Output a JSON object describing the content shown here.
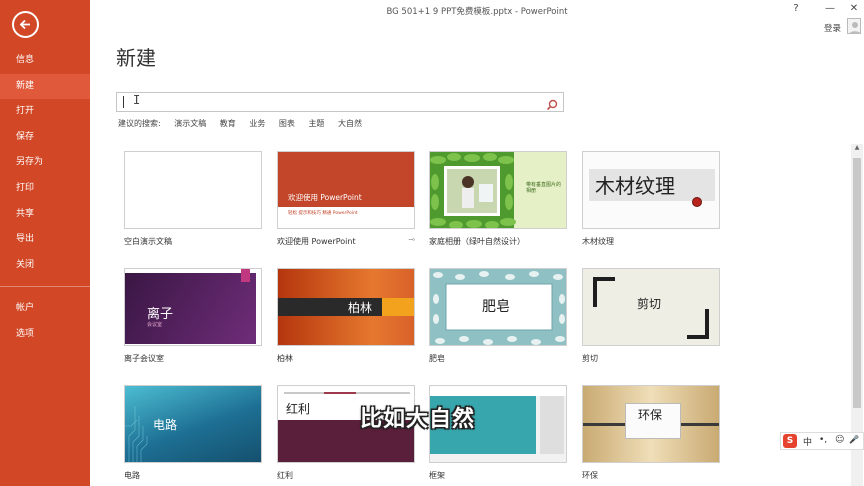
{
  "window": {
    "title": "BG 501+1 9 PPT免费模板.pptx - PowerPoint",
    "help": "?",
    "minimize": "—",
    "close": "✕",
    "login": "登录"
  },
  "sidebar": {
    "items": [
      {
        "label": "信息"
      },
      {
        "label": "新建"
      },
      {
        "label": "打开"
      },
      {
        "label": "保存"
      },
      {
        "label": "另存为"
      },
      {
        "label": "打印"
      },
      {
        "label": "共享"
      },
      {
        "label": "导出"
      },
      {
        "label": "关闭"
      },
      {
        "label": "帐户"
      },
      {
        "label": "选项"
      }
    ],
    "active": "新建"
  },
  "main": {
    "title": "新建",
    "search": {
      "value": "",
      "cursor": "I"
    },
    "suggest_label": "建议的搜索:",
    "suggestions": [
      "演示文稿",
      "教育",
      "业务",
      "图表",
      "主题",
      "大自然"
    ]
  },
  "templates": [
    {
      "label": "空白演示文稿",
      "thumb_text": ""
    },
    {
      "label": "欢迎使用 PowerPoint",
      "thumb_text": "欢迎使用 PowerPoint",
      "thumb_sub": "轻松 提示和技巧 精通 PowerPoint",
      "pin": "⊸"
    },
    {
      "label": "家庭相册（绿叶自然设计）",
      "thumb_text": "带有垂直图片的相册"
    },
    {
      "label": "木材纹理",
      "thumb_text": "木材纹理"
    },
    {
      "label": "离子会议室",
      "thumb_text": "离子",
      "thumb_sub": "会议室"
    },
    {
      "label": "柏林",
      "thumb_text": "柏林"
    },
    {
      "label": "肥皂",
      "thumb_text": "肥皂"
    },
    {
      "label": "剪切",
      "thumb_text": "剪切"
    },
    {
      "label": "电路",
      "thumb_text": "电路"
    },
    {
      "label": "红利",
      "thumb_text": "红利"
    },
    {
      "label": "框架",
      "thumb_text": ""
    },
    {
      "label": "环保",
      "thumb_text": "环保"
    }
  ],
  "subtitle": "比如大自然",
  "ime": {
    "logo": "S",
    "lang": "中",
    "punct": "•,",
    "emoji": "☺",
    "mic": "🎤"
  },
  "colors": {
    "accent": "#d24726"
  }
}
